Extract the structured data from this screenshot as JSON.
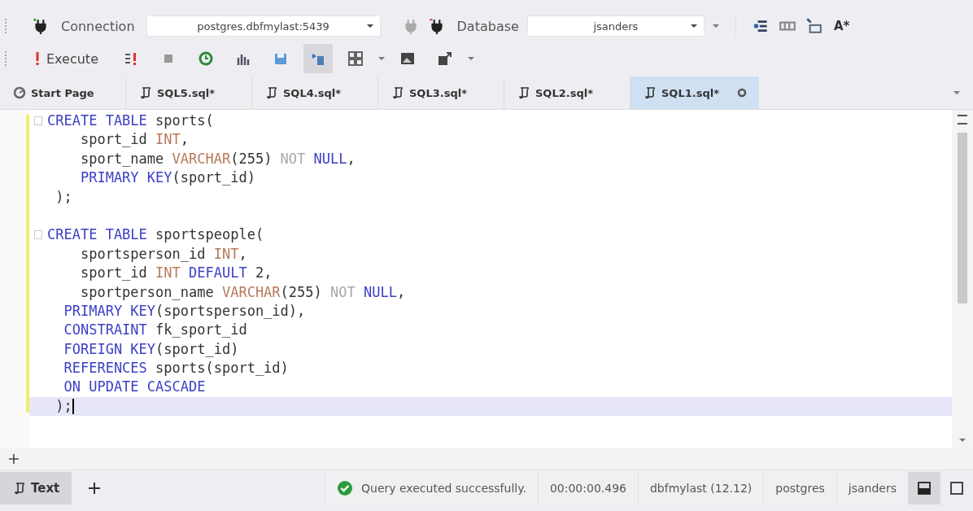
{
  "toolbar": {
    "connection_label": "Connection",
    "connection_value": "postgres.dbfmylast:5439",
    "database_label": "Database",
    "database_value": "jsanders",
    "font_button": "A*",
    "execute_label": "Execute",
    "buttons": [
      {
        "kind": "execute-current",
        "selected": false,
        "menu": false
      },
      {
        "kind": "stop",
        "selected": false,
        "menu": false
      },
      {
        "kind": "refresh",
        "selected": false,
        "menu": false
      },
      {
        "kind": "chart",
        "selected": false,
        "menu": false
      },
      {
        "kind": "save",
        "selected": false,
        "menu": false
      },
      {
        "kind": "load",
        "selected": true,
        "menu": false
      },
      {
        "kind": "grid",
        "selected": false,
        "menu": true
      },
      {
        "kind": "image",
        "selected": false,
        "menu": false
      },
      {
        "kind": "export",
        "selected": false,
        "menu": true
      }
    ]
  },
  "tabs": [
    {
      "label": "Start Page",
      "kind": "start",
      "selected": false
    },
    {
      "label": "SQL5.sql*",
      "kind": "sql",
      "selected": false
    },
    {
      "label": "SQL4.sql*",
      "kind": "sql",
      "selected": false
    },
    {
      "label": "SQL3.sql*",
      "kind": "sql",
      "selected": false
    },
    {
      "label": "SQL2.sql*",
      "kind": "sql",
      "selected": false
    },
    {
      "label": "SQL1.sql*",
      "kind": "sql",
      "selected": true
    }
  ],
  "editor": {
    "lines": [
      {
        "fold": true,
        "current": false,
        "tokens": [
          {
            "kind": "keyword",
            "text": "CREATE TABLE"
          },
          {
            "kind": "plain",
            "text": " sports("
          }
        ]
      },
      {
        "fold": false,
        "current": false,
        "tokens": [
          {
            "kind": "plain",
            "text": "    sport_id "
          },
          {
            "kind": "type",
            "text": "INT"
          },
          {
            "kind": "plain",
            "text": ","
          }
        ]
      },
      {
        "fold": false,
        "current": false,
        "tokens": [
          {
            "kind": "plain",
            "text": "    sport_name "
          },
          {
            "kind": "type",
            "text": "VARCHAR"
          },
          {
            "kind": "plain",
            "text": "(255) "
          },
          {
            "kind": "muted",
            "text": "NOT "
          },
          {
            "kind": "keyword",
            "text": "NULL"
          },
          {
            "kind": "plain",
            "text": ","
          }
        ]
      },
      {
        "fold": false,
        "current": false,
        "tokens": [
          {
            "kind": "keyword",
            "text": "    PRIMARY KEY"
          },
          {
            "kind": "plain",
            "text": "(sport_id)"
          }
        ]
      },
      {
        "fold": false,
        "current": false,
        "tokens": [
          {
            "kind": "plain",
            "text": " );"
          }
        ]
      },
      {
        "fold": false,
        "current": false
      },
      {
        "fold": true,
        "current": false,
        "tokens": [
          {
            "kind": "keyword",
            "text": "CREATE TABLE"
          },
          {
            "kind": "plain",
            "text": " sportspeople("
          }
        ]
      },
      {
        "fold": false,
        "current": false,
        "tokens": [
          {
            "kind": "plain",
            "text": "    sportsperson_id "
          },
          {
            "kind": "type",
            "text": "INT"
          },
          {
            "kind": "plain",
            "text": ","
          }
        ]
      },
      {
        "fold": false,
        "current": false,
        "tokens": [
          {
            "kind": "plain",
            "text": "    sport_id "
          },
          {
            "kind": "type",
            "text": "INT "
          },
          {
            "kind": "keyword",
            "text": "DEFAULT"
          },
          {
            "kind": "plain",
            "text": " 2,"
          }
        ]
      },
      {
        "fold": false,
        "current": false,
        "tokens": [
          {
            "kind": "plain",
            "text": "    sportperson_name "
          },
          {
            "kind": "type",
            "text": "VARCHAR"
          },
          {
            "kind": "plain",
            "text": "(255) "
          },
          {
            "kind": "muted",
            "text": "NOT "
          },
          {
            "kind": "keyword",
            "text": "NULL"
          },
          {
            "kind": "plain",
            "text": ","
          }
        ]
      },
      {
        "fold": false,
        "current": false,
        "tokens": [
          {
            "kind": "keyword",
            "text": "  PRIMARY KEY"
          },
          {
            "kind": "plain",
            "text": "(sportsperson_id),"
          }
        ]
      },
      {
        "fold": false,
        "current": false,
        "tokens": [
          {
            "kind": "keyword",
            "text": "  CONSTRAINT"
          },
          {
            "kind": "plain",
            "text": " fk_sport_id"
          }
        ]
      },
      {
        "fold": false,
        "current": false,
        "tokens": [
          {
            "kind": "keyword",
            "text": "  FOREIGN KEY"
          },
          {
            "kind": "plain",
            "text": "(sport_id)"
          }
        ]
      },
      {
        "fold": false,
        "current": false,
        "tokens": [
          {
            "kind": "keyword",
            "text": "  REFERENCES"
          },
          {
            "kind": "plain",
            "text": " sports(sport_id)"
          }
        ]
      },
      {
        "fold": false,
        "current": false,
        "tokens": [
          {
            "kind": "keyword",
            "text": "  ON UPDATE CASCADE"
          }
        ]
      },
      {
        "fold": false,
        "current": true,
        "tokens": [
          {
            "kind": "plain",
            "text": " );"
          }
        ]
      }
    ]
  },
  "bottom_tabs": [
    {
      "label": "Text",
      "selected": true
    }
  ],
  "status": {
    "message": "Query executed successfully.",
    "duration": "00:00:00.496",
    "server": "dbfmylast (12.12)",
    "user": "postgres",
    "database": "jsanders"
  }
}
